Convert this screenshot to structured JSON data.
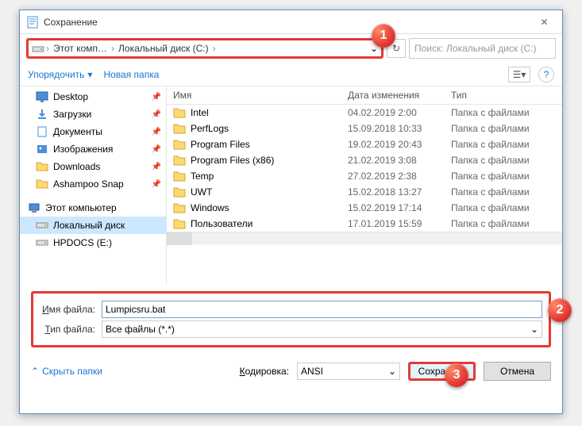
{
  "window": {
    "title": "Сохранение"
  },
  "path": {
    "seg1": "Этот комп…",
    "seg2": "Локальный диск (C:)"
  },
  "search": {
    "placeholder": "Поиск: Локальный диск (C:)"
  },
  "toolbar": {
    "organize": "Упорядочить",
    "newfolder": "Новая папка"
  },
  "sidebar": {
    "items": [
      {
        "label": "Desktop",
        "pinned": true
      },
      {
        "label": "Загрузки",
        "pinned": true
      },
      {
        "label": "Документы",
        "pinned": true
      },
      {
        "label": "Изображения",
        "pinned": true
      },
      {
        "label": "Downloads",
        "pinned": true
      },
      {
        "label": "Ashampoo Snap",
        "pinned": true
      }
    ],
    "pc": "Этот компьютер",
    "drives": [
      {
        "label": "Локальный диск",
        "selected": true
      },
      {
        "label": "HPDOCS (E:)"
      }
    ]
  },
  "columns": {
    "name": "Имя",
    "date": "Дата изменения",
    "type": "Тип"
  },
  "files": [
    {
      "name": "Intel",
      "date": "04.02.2019 2:00",
      "type": "Папка с файлами"
    },
    {
      "name": "PerfLogs",
      "date": "15.09.2018 10:33",
      "type": "Папка с файлами"
    },
    {
      "name": "Program Files",
      "date": "19.02.2019 20:43",
      "type": "Папка с файлами"
    },
    {
      "name": "Program Files (x86)",
      "date": "21.02.2019 3:08",
      "type": "Папка с файлами"
    },
    {
      "name": "Temp",
      "date": "27.02.2019 2:38",
      "type": "Папка с файлами"
    },
    {
      "name": "UWT",
      "date": "15.02.2018 13:27",
      "type": "Папка с файлами"
    },
    {
      "name": "Windows",
      "date": "15.02.2019 17:14",
      "type": "Папка с файлами"
    },
    {
      "name": "Пользователи",
      "date": "17.01.2019 15:59",
      "type": "Папка с файлами"
    }
  ],
  "form": {
    "filename_label": "Имя файла:",
    "filename_value": "Lumpicsru.bat",
    "filetype_label": "Тип файла:",
    "filetype_value": "Все файлы  (*.*)"
  },
  "bottom": {
    "hide": "Скрыть папки",
    "encoding_label": "Кодировка:",
    "encoding_value": "ANSI",
    "save": "Сохранить",
    "cancel": "Отмена"
  },
  "badges": {
    "b1": "1",
    "b2": "2",
    "b3": "3"
  }
}
